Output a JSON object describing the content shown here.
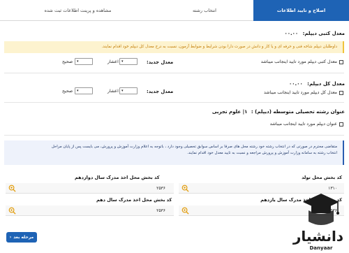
{
  "tabs": [
    {
      "label": "اصلاح و تایید اطلاعات",
      "active": true
    },
    {
      "label": "انتخاب رشته",
      "active": false
    },
    {
      "label": "مشاهده و پرینت اطلاعات ثبت شده",
      "active": false
    }
  ],
  "written_diploma": {
    "title": "معدل کتبی دیپلم:",
    "value": "۰۰.۰۰",
    "notice": "داوطلبان دیپلم شاخه فنی و حرفه ای و یا کار و دانش در صورت دارا بودن شرایط و ضوابط آزمون، نسبت به درج معدل کل دیپلم خود اقدام نمایند.",
    "confirm_label": "معدل کتبی دیپلم مورد تایید اینجانب میباشد",
    "new_avg_label": "معدل جدید:",
    "decimal_label": "اعشار",
    "integer_label": "صحیح"
  },
  "total_diploma": {
    "title": "معدل کل دیپلم:",
    "value": "۰۰.۰۰",
    "confirm_label": "معدل کل دیپلم مورد تایید اینجانب میباشد",
    "new_avg_label": "معدل جدید:",
    "decimal_label": "اعشار",
    "integer_label": "صحیح"
  },
  "field_of_study": {
    "title": "عنوان رشته تحصیلی متوسطه (دیپلم) :",
    "value": "۱| علوم تجربی",
    "confirm_label": "عنوان دیپلم مورد تایید اینجانب میباشد"
  },
  "info_box": {
    "line1": "متقاضی محترم در صورتی که در انتخاب رشته خود رشته محل های صرفا بر اساس سوابق تحصیلی وجود دارد ، باتوجه به اعلام وزارت آموزش و پرورش، می بایست پس از پایان مراحل",
    "line2": "انتخاب رشته به سامانه وزارت آموزش و پرورش مراجعه و نسبت به تایید معدل خود اقدام نمایند."
  },
  "fields": {
    "birth_place": {
      "label": "کد بخش محل تولد",
      "value": "۱۳۱۰"
    },
    "grade12_place": {
      "label": "کد بخش محل اخذ مدرک سال دوازدهم",
      "value": "۲۵۳۶"
    },
    "grade11_place": {
      "label": "کد بخش محل اخذ مدرک سال یازدهم",
      "value": "۲۵۳۶"
    },
    "grade10_place": {
      "label": "کد بخش محل اخذ مدرک سال دهم",
      "value": "۲۵۳۶"
    }
  },
  "next_button": {
    "label": "مرحله بعد",
    "icon": "chevron-left-icon"
  },
  "watermark": {
    "text": "دانشیار",
    "subtext": "Danyaar"
  },
  "colors": {
    "primary": "#1e63b5",
    "warning_bg": "#fdf3cf",
    "warning_text": "#c27a00",
    "info_bg": "#eef2fb",
    "zoom_icon": "#e3a21a"
  }
}
